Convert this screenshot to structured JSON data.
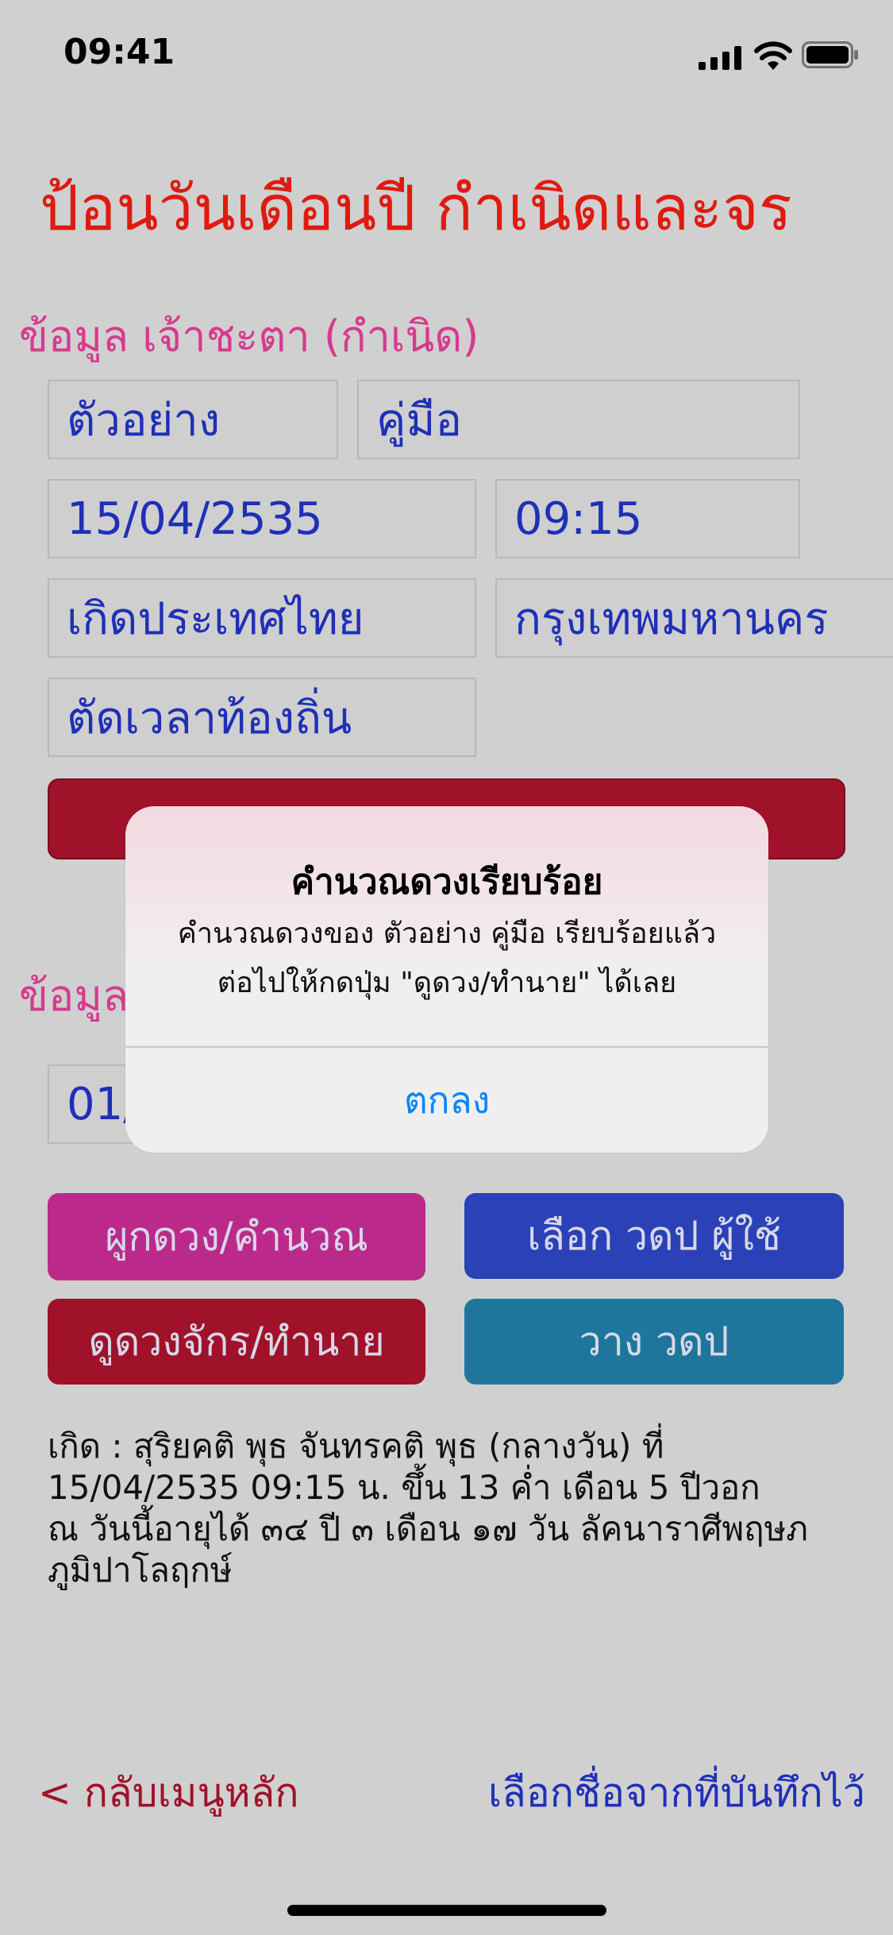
{
  "status_bar": {
    "time": "09:41"
  },
  "page_title": "ป้อนวันเดือนปี กำเนิดและจร",
  "owner_section": {
    "label": "ข้อมูล เจ้าชะตา (กำเนิด)",
    "first_name": "ตัวอย่าง",
    "last_name": "คู่มือ",
    "birth_date": "15/04/2535",
    "birth_time": "09:15",
    "birth_country": "เกิดประเทศไทย",
    "birth_province": "กรุงเทพมหานคร",
    "time_zone": "ตัดเวลาท้องถิ่น"
  },
  "transit_section": {
    "label": "ข้อมูล",
    "date_partial": "01/"
  },
  "buttons": {
    "calc": "ผูกดวง/คำนวณ",
    "select_transit": "เลือก วดป ผู้ใช้",
    "read": "ดูดวงจักร/ทำนาย",
    "place_transit": "วาง วดป"
  },
  "result_lines": [
    "เกิด : สุริยคติ พุธ  จันทรคติ พุธ (กลางวัน) ที่",
    "15/04/2535 09:15 น.  ขึ้น 13 ค่ำ เดือน 5 ปีวอก",
    "ณ วันนี้อายุได้ ๓๔ ปี ๓ เดือน ๑๗ วัน ลัคนาราศีพฤษภ",
    "ภูมิปาโลฤกษ์"
  ],
  "footer": {
    "back": "< กลับเมนูหลัก",
    "saved": "เลือกชื่อจากที่บันทึกไว้"
  },
  "alert": {
    "title": "คำนวณดวงเรียบร้อย",
    "message_line1": "คำนวณดวงของ ตัวอย่าง คู่มือ เรียบร้อยแล้ว",
    "message_line2": "ต่อไปให้กดปุ่ม \"ดูดวง/ทำนาย\" ได้เลย",
    "ok": "ตกลง"
  },
  "colors": {
    "title": "#e01a10",
    "section": "#d63a8e",
    "field_text": "#1f2fb8",
    "alert_button": "#0a84ff"
  }
}
